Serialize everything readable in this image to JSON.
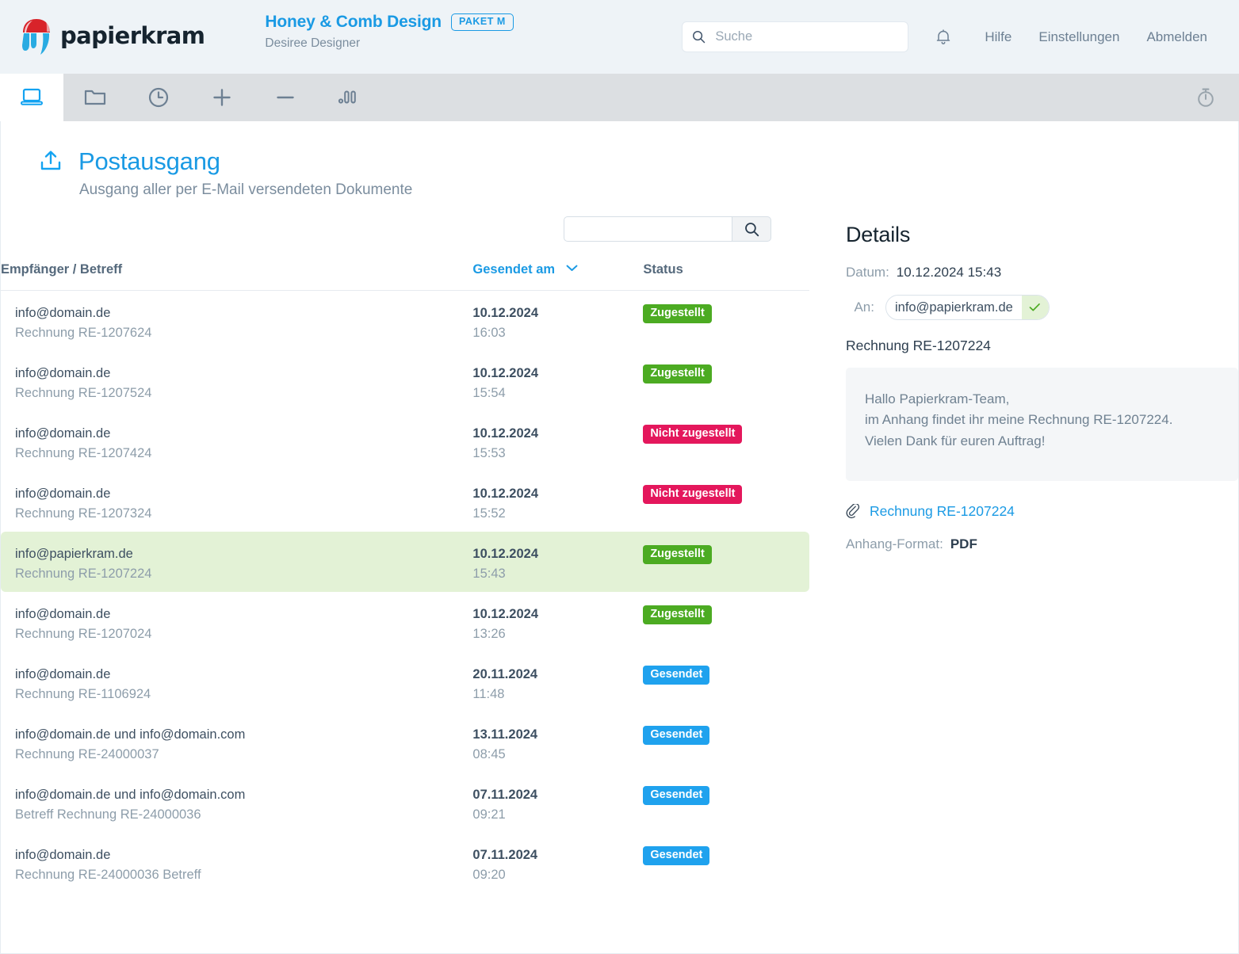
{
  "header": {
    "brand": "papierkram",
    "company_name": "Honey & Comb Design",
    "plan_badge": "PAKET M",
    "user_name": "Desiree Designer",
    "search_placeholder": "Suche",
    "search_value": "",
    "nav": {
      "help": "Hilfe",
      "settings": "Einstellungen",
      "logout": "Abmelden"
    }
  },
  "toolbar": {
    "items": [
      {
        "icon": "laptop-icon",
        "active": true
      },
      {
        "icon": "folder-icon",
        "active": false
      },
      {
        "icon": "clock-icon",
        "active": false
      },
      {
        "icon": "plus-icon",
        "active": false
      },
      {
        "icon": "minus-icon",
        "active": false
      },
      {
        "icon": "bar-chart-icon",
        "active": false
      }
    ],
    "right_icon": "stopwatch-icon"
  },
  "page": {
    "title": "Postausgang",
    "subtitle": "Ausgang aller per E-Mail versendeten Dokumente",
    "title_icon": "outbox-upload-icon"
  },
  "table_search": {
    "value": "",
    "placeholder": "",
    "button_icon": "search-icon"
  },
  "table": {
    "columns": {
      "recipient": "Empfänger / Betreff",
      "sent_at": "Gesendet am",
      "status": "Status"
    },
    "sort_column": "Gesendet am",
    "sort_direction": "desc",
    "rows": [
      {
        "to": "info@domain.de",
        "subject": "Rechnung RE-1207624",
        "date": "10.12.2024",
        "time": "16:03",
        "status": "Zugestellt",
        "status_color": "green",
        "selected": false
      },
      {
        "to": "info@domain.de",
        "subject": "Rechnung RE-1207524",
        "date": "10.12.2024",
        "time": "15:54",
        "status": "Zugestellt",
        "status_color": "green",
        "selected": false
      },
      {
        "to": "info@domain.de",
        "subject": "Rechnung RE-1207424",
        "date": "10.12.2024",
        "time": "15:53",
        "status": "Nicht zugestellt",
        "status_color": "red",
        "selected": false
      },
      {
        "to": "info@domain.de",
        "subject": "Rechnung RE-1207324",
        "date": "10.12.2024",
        "time": "15:52",
        "status": "Nicht zugestellt",
        "status_color": "red",
        "selected": false
      },
      {
        "to": "info@papierkram.de",
        "subject": "Rechnung RE-1207224",
        "date": "10.12.2024",
        "time": "15:43",
        "status": "Zugestellt",
        "status_color": "green",
        "selected": true
      },
      {
        "to": "info@domain.de",
        "subject": "Rechnung RE-1207024",
        "date": "10.12.2024",
        "time": "13:26",
        "status": "Zugestellt",
        "status_color": "green",
        "selected": false
      },
      {
        "to": "info@domain.de",
        "subject": "Rechnung RE-1106924",
        "date": "20.11.2024",
        "time": "11:48",
        "status": "Gesendet",
        "status_color": "blue",
        "selected": false
      },
      {
        "to": "info@domain.de und info@domain.com",
        "subject": "Rechnung RE-24000037",
        "date": "13.11.2024",
        "time": "08:45",
        "status": "Gesendet",
        "status_color": "blue",
        "selected": false
      },
      {
        "to": "info@domain.de und info@domain.com",
        "subject": "Betreff Rechnung RE-24000036",
        "date": "07.11.2024",
        "time": "09:21",
        "status": "Gesendet",
        "status_color": "blue",
        "selected": false
      },
      {
        "to": "info@domain.de",
        "subject": "Rechnung RE-24000036 Betreff",
        "date": "07.11.2024",
        "time": "09:20",
        "status": "Gesendet",
        "status_color": "blue",
        "selected": false
      }
    ]
  },
  "details": {
    "title": "Details",
    "date_label": "Datum:",
    "date_value": "10.12.2024 15:43",
    "to_label": "An:",
    "to_value": "info@papierkram.de",
    "to_status_icon": "check-icon",
    "subject": "Rechnung RE-1207224",
    "message_lines": [
      "Hallo Papierkram-Team,",
      "im Anhang findet ihr meine Rechnung RE-1207224.",
      "Vielen Dank für euren Auftrag!"
    ],
    "attachment_icon": "paperclip-icon",
    "attachment_name": "Rechnung RE-1207224",
    "format_label": "Anhang-Format:",
    "format_value": "PDF"
  },
  "colors": {
    "accent_blue": "#1a9ae4",
    "status_green": "#4cab22",
    "status_red": "#e4175c",
    "status_blue": "#1fa2ee",
    "selected_row": "#e3f2d6",
    "header_bg": "#eef3f7",
    "toolbar_bg": "#dcdfe2"
  }
}
